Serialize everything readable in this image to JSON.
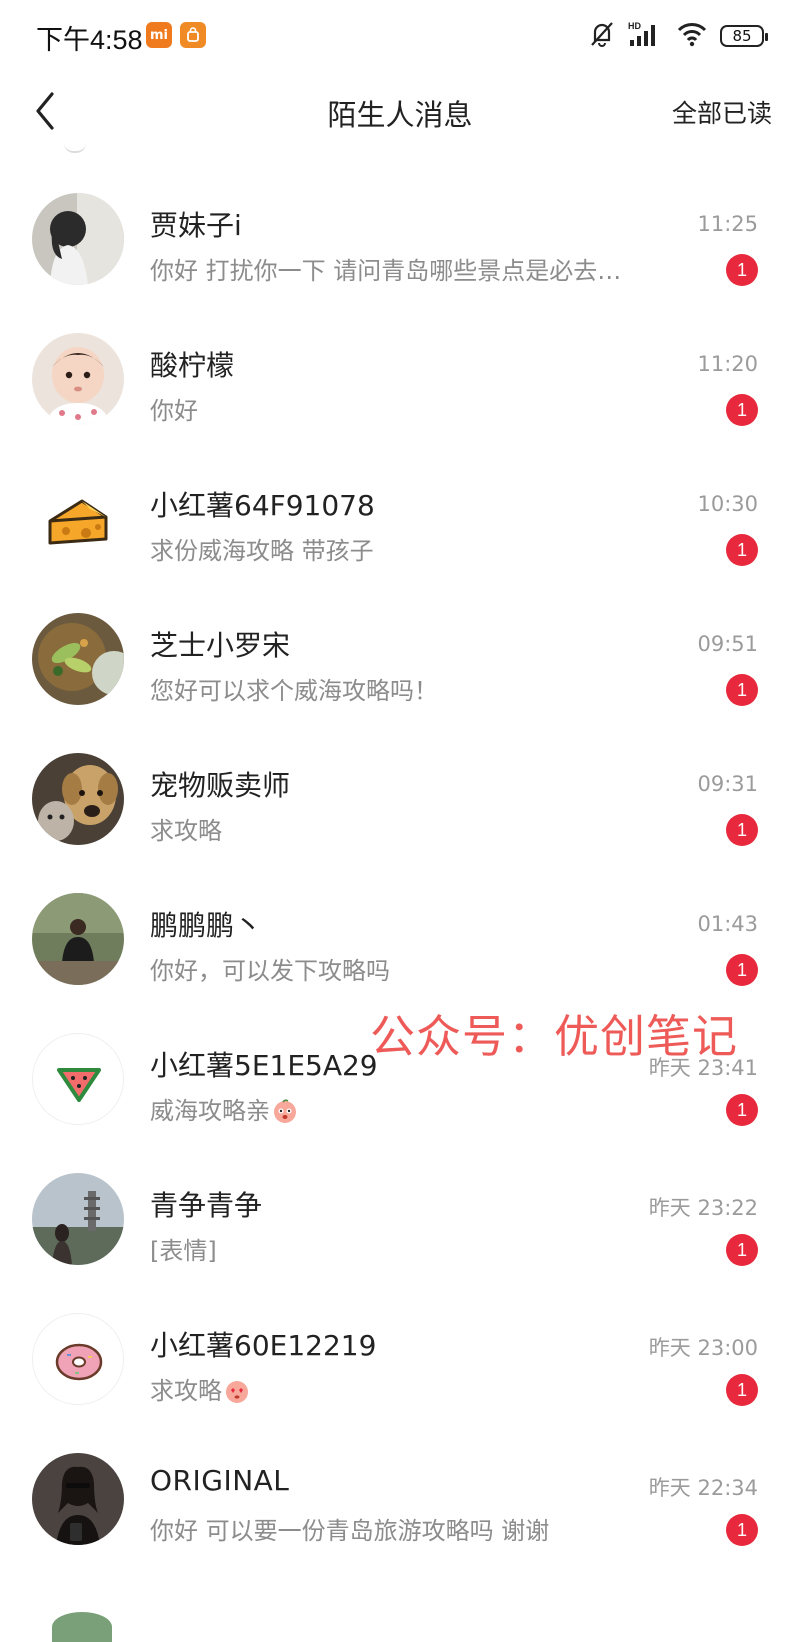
{
  "status_bar": {
    "time": "下午4:58",
    "battery": "85",
    "icons": [
      "mi-app-icon",
      "shop-app-icon",
      "mute-bell-icon",
      "hd-signal-icon",
      "wifi-icon",
      "battery-icon"
    ]
  },
  "header": {
    "back_icon": "chevron-left-icon",
    "title": "陌生人消息",
    "read_all": "全部已读"
  },
  "colors": {
    "badge": "#e8283c",
    "watermark": "#ee5a57"
  },
  "messages": [
    {
      "name": "贾妹子i",
      "time": "11:25",
      "preview": "你好 打扰你一下 请问青岛哪些景点是必去…",
      "unread": "1",
      "avatar": "photo-avatar"
    },
    {
      "name": "酸柠檬",
      "time": "11:20",
      "preview": "你好",
      "unread": "1",
      "avatar": "baby-photo-avatar"
    },
    {
      "name": "小红薯64F91078",
      "time": "10:30",
      "preview": "求份威海攻略 带孩子",
      "unread": "1",
      "avatar": "cheese-avatar"
    },
    {
      "name": "芝士小罗宋",
      "time": "09:51",
      "preview": "您好可以求个威海攻略吗！",
      "unread": "1",
      "avatar": "food-photo-avatar"
    },
    {
      "name": "宠物贩卖师",
      "time": "09:31",
      "preview": "求攻略",
      "unread": "1",
      "avatar": "dog-cat-photo-avatar"
    },
    {
      "name": "鹏鹏鹏丶",
      "time": "01:43",
      "preview": "你好，可以发下攻略吗",
      "unread": "1",
      "avatar": "person-photo-avatar"
    },
    {
      "name": "小红薯5E1E5A29",
      "time": "昨天 23:41",
      "preview": "威海攻略亲",
      "unread": "1",
      "avatar": "watermelon-avatar",
      "emoji": "peach-emoji"
    },
    {
      "name": "青争青争",
      "time": "昨天 23:22",
      "preview": "[表情]",
      "unread": "1",
      "avatar": "pagoda-photo-avatar"
    },
    {
      "name": "小红薯60E12219",
      "time": "昨天 23:00",
      "preview": "求攻略",
      "unread": "1",
      "avatar": "donut-avatar",
      "emoji": "heart-eyes-emoji"
    },
    {
      "name": "ORIGINAL",
      "time": "昨天 22:34",
      "preview": "你好 可以要一份青岛旅游攻略吗 谢谢",
      "unread": "1",
      "avatar": "selfie-photo-avatar"
    }
  ],
  "watermark": "公众号：优创笔记"
}
